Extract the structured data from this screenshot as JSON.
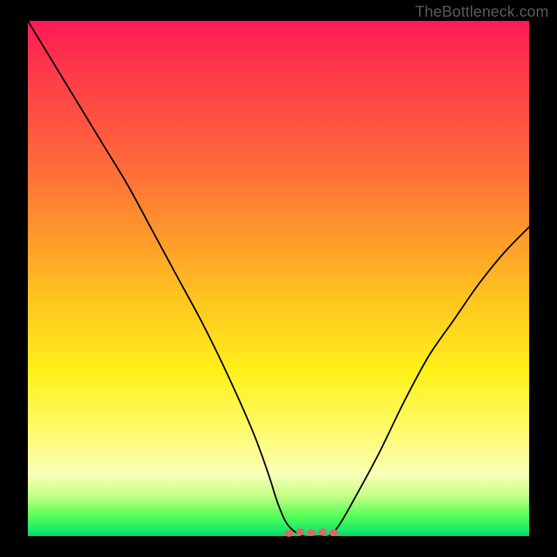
{
  "watermark": "TheBottleneck.com",
  "chart_data": {
    "type": "line",
    "title": "",
    "xlabel": "",
    "ylabel": "",
    "xlim": [
      0,
      100
    ],
    "ylim": [
      0,
      100
    ],
    "grid": false,
    "legend": false,
    "x": [
      0,
      5,
      10,
      15,
      20,
      25,
      30,
      35,
      40,
      45,
      48,
      50,
      52,
      55,
      58,
      60,
      62,
      65,
      70,
      75,
      80,
      85,
      90,
      95,
      100
    ],
    "series": [
      {
        "name": "curve",
        "color": "#000000",
        "values": [
          100,
          92,
          84,
          76,
          68,
          59,
          50,
          41,
          31,
          20,
          12,
          6,
          2,
          0,
          0,
          0,
          2,
          7,
          16,
          26,
          35,
          42,
          49,
          55,
          60
        ]
      }
    ],
    "highlight": {
      "color": "#d86a6a",
      "x_range": [
        52,
        62
      ],
      "y": 0,
      "description": "flat bottom of curve marked with thick pale-red dotted segment"
    },
    "background_gradient": {
      "type": "vertical",
      "stops": [
        {
          "pos": 0,
          "color": "#ff1a55"
        },
        {
          "pos": 28,
          "color": "#ff6a3a"
        },
        {
          "pos": 55,
          "color": "#ffc81f"
        },
        {
          "pos": 80,
          "color": "#fffb70"
        },
        {
          "pos": 96,
          "color": "#58ff58"
        },
        {
          "pos": 100,
          "color": "#00d474"
        }
      ]
    }
  }
}
